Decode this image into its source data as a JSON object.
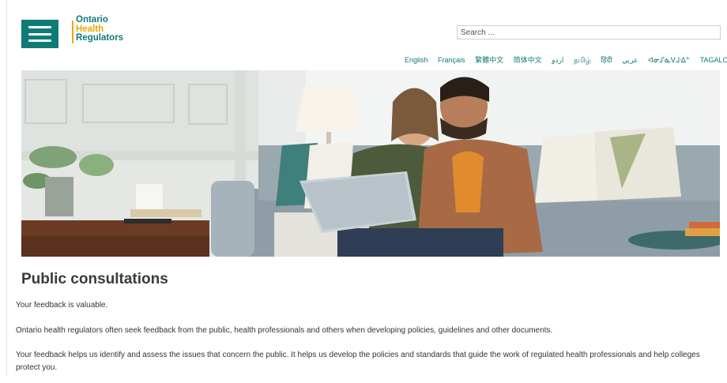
{
  "header": {
    "menu_label": "Menu",
    "logo": {
      "line1": "Ontario",
      "line2": "Health",
      "line3": "Regulators"
    },
    "search": {
      "placeholder": "Search ..."
    },
    "languages": [
      "English",
      "Français",
      "繁體中文",
      "简体中文",
      "اردو",
      "தமிழ்",
      "हिंदी",
      "عربي",
      "ᐊᓂᔑᓈᐯᒧᐎᓐ",
      "TAGALOG"
    ]
  },
  "hero": {
    "image_description": "Couple sitting on a sofa looking at a laptop"
  },
  "main": {
    "title": "Public consultations",
    "paragraphs": [
      "Your feedback is valuable.",
      "Ontario health regulators often seek feedback from the public, health professionals and others when developing policies, guidelines and other documents.",
      "Your feedback helps us identify and assess the issues that concern the public. It helps us develop the policies and standards that guide the work of regulated health professionals and help colleges protect you."
    ]
  },
  "colors": {
    "brand_teal": "#0f7b78",
    "brand_gold": "#f0a500"
  }
}
